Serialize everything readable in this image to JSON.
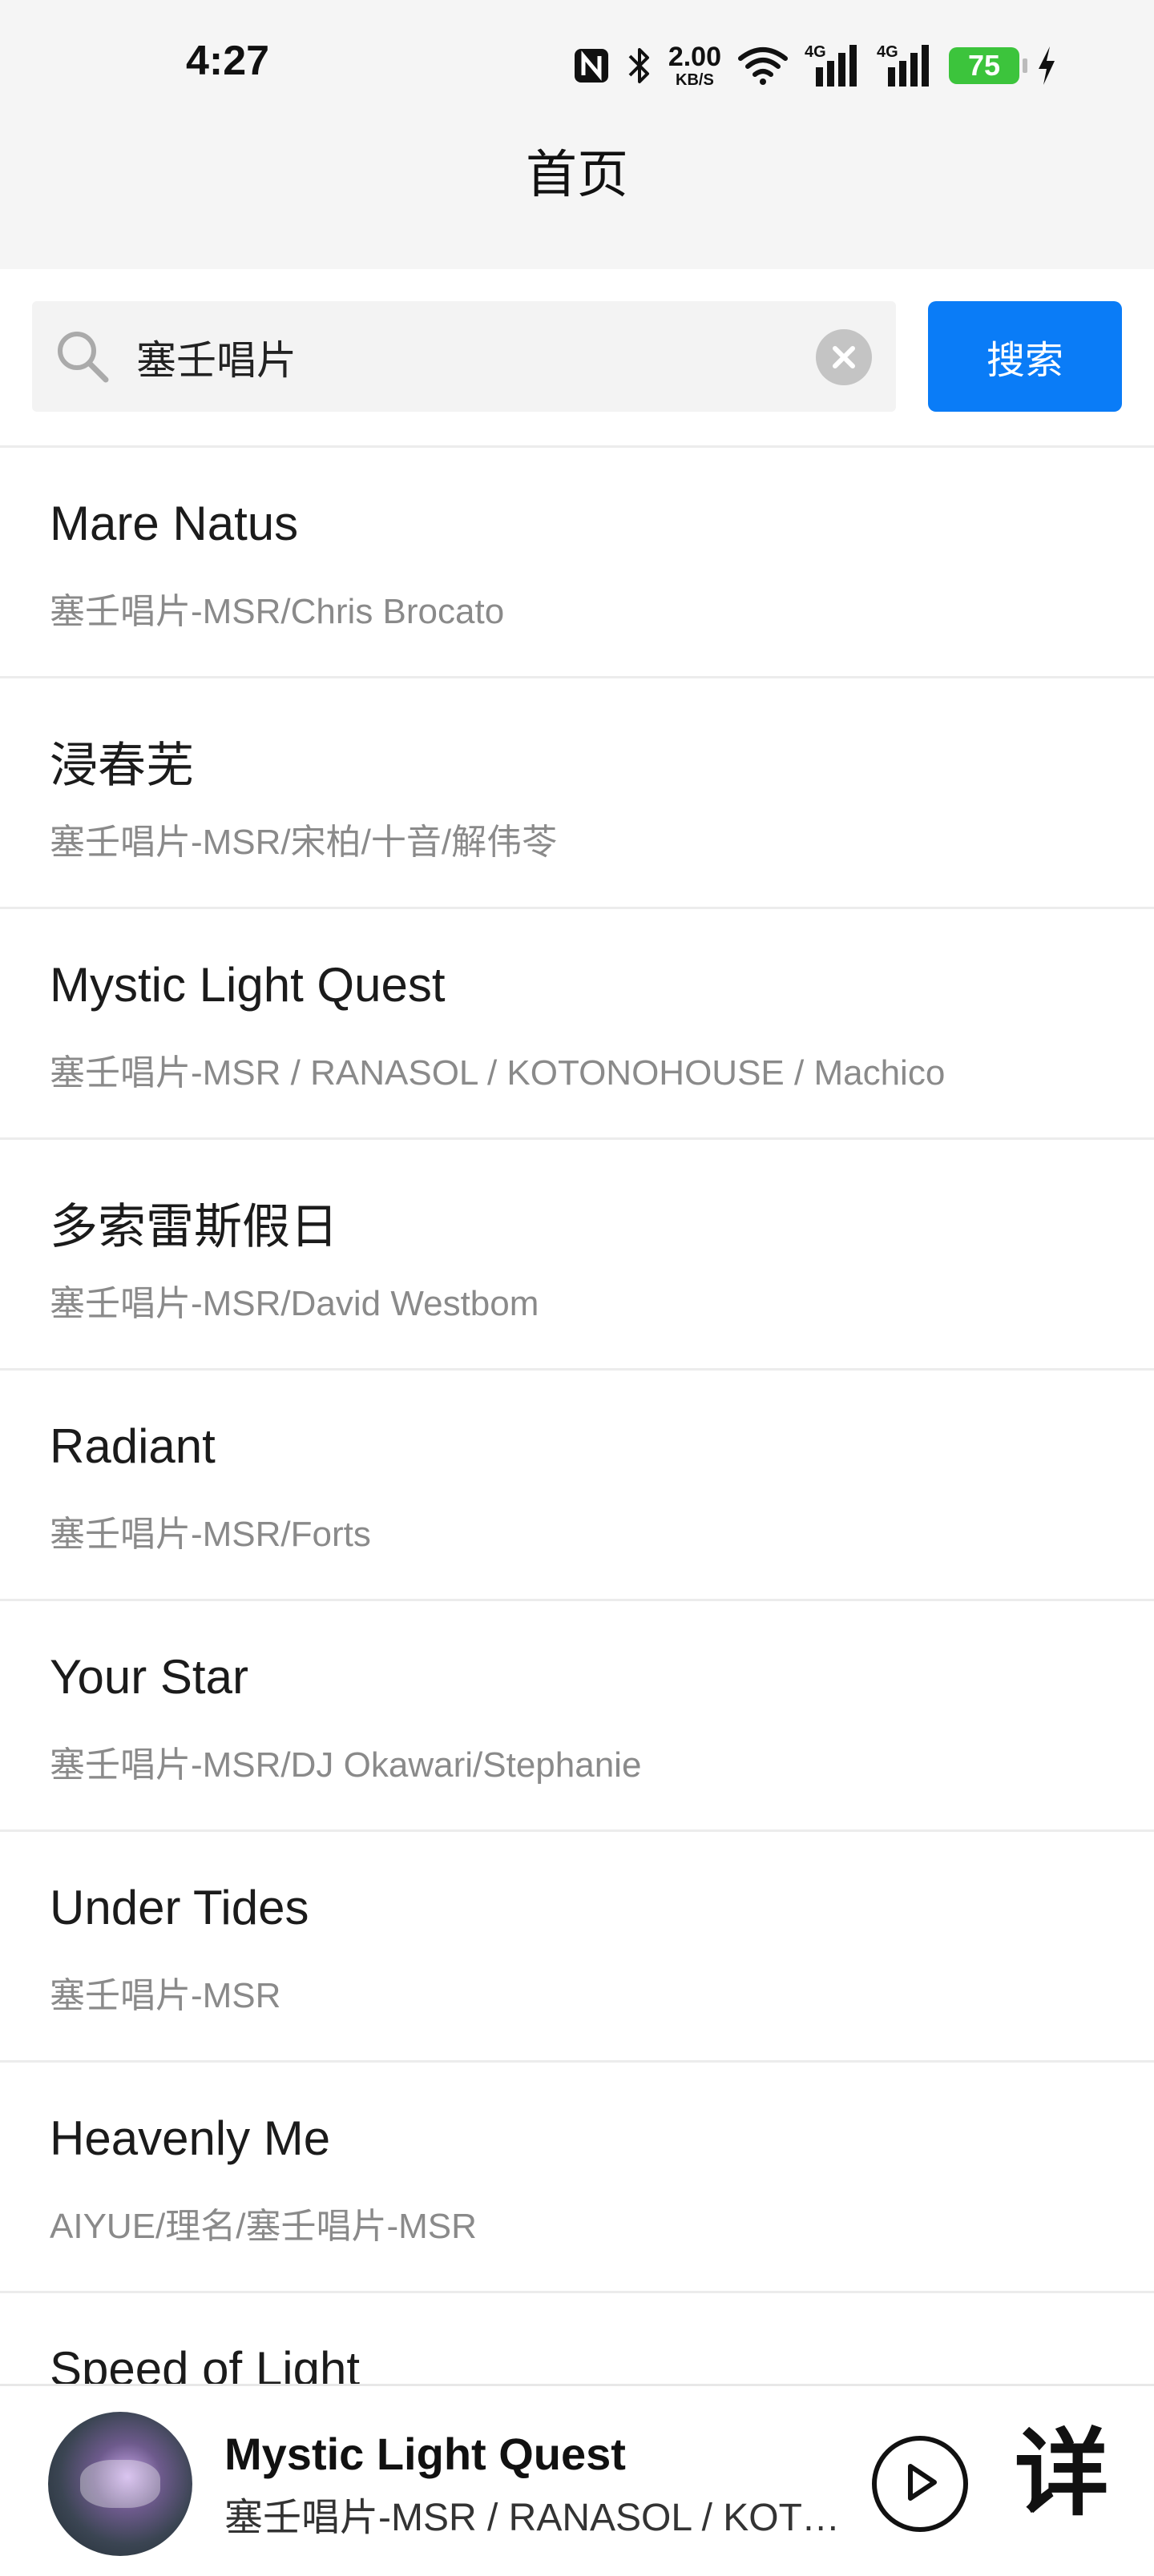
{
  "status_bar": {
    "time": "4:27",
    "net_speed_value": "2.00",
    "net_speed_unit": "KB/S",
    "signal1_tag": "4G",
    "signal2_tag": "4G",
    "battery": "75",
    "icons": [
      "nfc-icon",
      "bluetooth-icon",
      "wifi-icon",
      "signal-icon",
      "signal-icon",
      "battery-icon",
      "charging-icon"
    ]
  },
  "header": {
    "title": "首页"
  },
  "search": {
    "value": "塞壬唱片",
    "button_label": "搜索"
  },
  "songs": [
    {
      "title": "Mare Natus",
      "artist": "塞壬唱片-MSR/Chris Brocato"
    },
    {
      "title": "浸春芜",
      "artist": "塞壬唱片-MSR/宋柏/十音/解伟苓"
    },
    {
      "title": "Mystic Light Quest",
      "artist": "塞壬唱片-MSR / RANASOL / KOTONOHOUSE / Machico"
    },
    {
      "title": "多索雷斯假日",
      "artist": "塞壬唱片-MSR/David Westbom"
    },
    {
      "title": "Radiant",
      "artist": "塞壬唱片-MSR/Forts"
    },
    {
      "title": "Your Star",
      "artist": "塞壬唱片-MSR/DJ Okawari/Stephanie"
    },
    {
      "title": "Under Tides",
      "artist": "塞壬唱片-MSR"
    },
    {
      "title": "Heavenly Me",
      "artist": "AIYUE/理名/塞壬唱片-MSR"
    },
    {
      "title": "Speed of Light",
      "artist": ""
    }
  ],
  "player": {
    "title": "Mystic Light Quest",
    "artist": "塞壬唱片-MSR / RANASOL / KOTONOHOUSE / Machico",
    "detail_label": "详"
  },
  "colors": {
    "accent": "#0a7cf7",
    "battery": "#3cc43c"
  }
}
